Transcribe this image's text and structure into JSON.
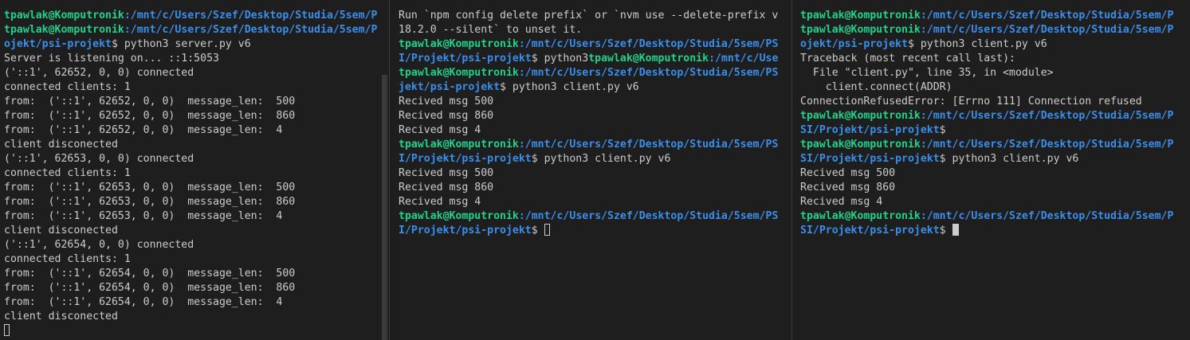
{
  "colors": {
    "background": "#1e1e1e",
    "text": "#cccccc",
    "prompt_user": "#23d18b",
    "prompt_path": "#3b8eea",
    "pane_divider": "#3c3c3c"
  },
  "panes": [
    {
      "lines": [
        {
          "u": "tpawlak@Komputronik",
          "p": ":/mnt/c/Users/Szef/Desktop/Studia/5sem/P"
        },
        {
          "u": "tpawlak@Komputronik",
          "p": ":/mnt/c/Users/Szef/Desktop/Studia/5sem/P"
        },
        {
          "p": "ojekt/psi-projekt",
          "t": "$ python3 server.py v6"
        },
        {
          "t": "Server is listening on... ::1:5053"
        },
        {
          "t": "('::1', 62652, 0, 0) connected"
        },
        {
          "t": "connected clients: 1"
        },
        {
          "t": "from:  ('::1', 62652, 0, 0)  message_len:  500"
        },
        {
          "t": "from:  ('::1', 62652, 0, 0)  message_len:  860"
        },
        {
          "t": "from:  ('::1', 62652, 0, 0)  message_len:  4"
        },
        {
          "t": "client disconected"
        },
        {
          "t": "('::1', 62653, 0, 0) connected"
        },
        {
          "t": "connected clients: 1"
        },
        {
          "t": "from:  ('::1', 62653, 0, 0)  message_len:  500"
        },
        {
          "t": "from:  ('::1', 62653, 0, 0)  message_len:  860"
        },
        {
          "t": "from:  ('::1', 62653, 0, 0)  message_len:  4"
        },
        {
          "t": "client disconected"
        },
        {
          "t": "('::1', 62654, 0, 0) connected"
        },
        {
          "t": "connected clients: 1"
        },
        {
          "t": "from:  ('::1', 62654, 0, 0)  message_len:  500"
        },
        {
          "t": "from:  ('::1', 62654, 0, 0)  message_len:  860"
        },
        {
          "t": "from:  ('::1', 62654, 0, 0)  message_len:  4"
        },
        {
          "t": "client disconected"
        },
        {
          "cursor": "hollow"
        }
      ]
    },
    {
      "lines": [
        {
          "t": "Run `npm config delete prefix` or `nvm use --delete-prefix v"
        },
        {
          "t": "18.2.0 --silent` to unset it."
        },
        {
          "u": "tpawlak@Komputronik",
          "p": ":/mnt/c/Users/Szef/Desktop/Studia/5sem/PS"
        },
        {
          "p": "I/Projekt/psi-projekt",
          "t": "$ python3",
          "u2": "tpawlak@Komputronik",
          "p2": ":/mnt/c/Use"
        },
        {
          "u": "tpawlak@Komputronik",
          "p": ":/mnt/c/Users/Szef/Desktop/Studia/5sem/PS"
        },
        {
          "p": "jekt/psi-projekt",
          "t": "$ python3 client.py v6"
        },
        {
          "t": "Recived msg 500"
        },
        {
          "t": "Recived msg 860"
        },
        {
          "t": "Recived msg 4"
        },
        {
          "u": "tpawlak@Komputronik",
          "p": ":/mnt/c/Users/Szef/Desktop/Studia/5sem/PS"
        },
        {
          "p": "I/Projekt/psi-projekt",
          "t": "$ python3 client.py v6"
        },
        {
          "t": "Recived msg 500"
        },
        {
          "t": "Recived msg 860"
        },
        {
          "t": "Recived msg 4"
        },
        {
          "u": "tpawlak@Komputronik",
          "p": ":/mnt/c/Users/Szef/Desktop/Studia/5sem/PS"
        },
        {
          "p": "I/Projekt/psi-projekt",
          "t": "$ ",
          "cursor": "hollow"
        }
      ]
    },
    {
      "lines": [
        {
          "u": "tpawlak@Komputronik",
          "p": ":/mnt/c/Users/Szef/Desktop/Studia/5sem/P"
        },
        {
          "u": "tpawlak@Komputronik",
          "p": ":/mnt/c/Users/Szef/Desktop/Studia/5sem/P"
        },
        {
          "p": "ojekt/psi-projekt",
          "t": "$ python3 client.py v6"
        },
        {
          "t": "Traceback (most recent call last):"
        },
        {
          "t": "  File \"client.py\", line 35, in <module>"
        },
        {
          "t": "    client.connect(ADDR)"
        },
        {
          "t": "ConnectionRefusedError: [Errno 111] Connection refused"
        },
        {
          "u": "tpawlak@Komputronik",
          "p": ":/mnt/c/Users/Szef/Desktop/Studia/5sem/P"
        },
        {
          "p": "SI/Projekt/psi-projekt",
          "t": "$"
        },
        {
          "u": "tpawlak@Komputronik",
          "p": ":/mnt/c/Users/Szef/Desktop/Studia/5sem/P"
        },
        {
          "p": "SI/Projekt/psi-projekt",
          "t": "$ python3 client.py v6"
        },
        {
          "t": "Recived msg 500"
        },
        {
          "t": "Recived msg 860"
        },
        {
          "t": "Recived msg 4"
        },
        {
          "u": "tpawlak@Komputronik",
          "p": ":/mnt/c/Users/Szef/Desktop/Studia/5sem/P"
        },
        {
          "p": "SI/Projekt/psi-projekt",
          "t": "$ ",
          "cursor": "solid"
        }
      ]
    }
  ]
}
